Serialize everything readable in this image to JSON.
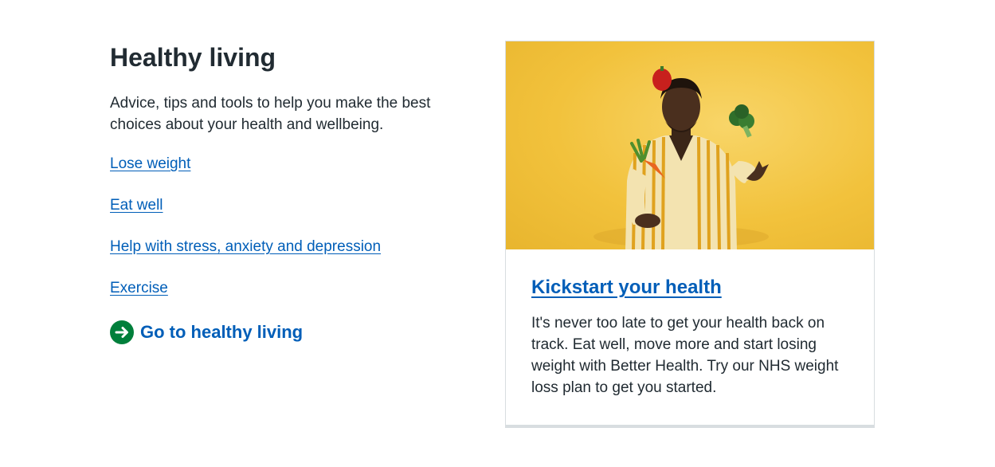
{
  "healthy_living": {
    "title": "Healthy living",
    "intro": "Advice, tips and tools to help you make the best choices about your health and wellbeing.",
    "links": [
      {
        "label": "Lose weight"
      },
      {
        "label": "Eat well"
      },
      {
        "label": "Help with stress, anxiety and depression"
      },
      {
        "label": "Exercise"
      }
    ],
    "action_link": {
      "label": "Go to healthy living",
      "icon": "arrow-right-circle-icon"
    }
  },
  "promo_card": {
    "image": "man-juggling-vegetables-image",
    "heading": "Kickstart your health",
    "description": "It's never too late to get your health back on track. Eat well, move more and start losing weight with Better Health. Try our NHS weight loss plan to get you started."
  },
  "colors": {
    "link": "#005eb8",
    "text": "#212b32",
    "action_icon": "#007f3b",
    "card_image_background": "#f2c23c",
    "card_border": "#d8dde0"
  }
}
